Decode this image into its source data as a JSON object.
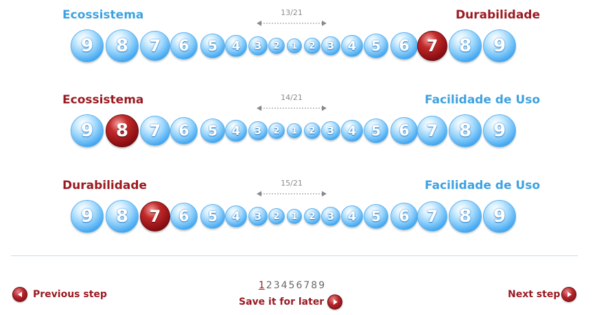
{
  "ball_numbers": [
    "9",
    "8",
    "7",
    "6",
    "5",
    "4",
    "3",
    "2",
    "1",
    "2",
    "3",
    "4",
    "5",
    "6",
    "7",
    "8",
    "9"
  ],
  "colors": {
    "blue_label": "#3ea2e0",
    "red_label": "#9a1b22",
    "selected": "#8c0f14",
    "ball": "#8fd0fb"
  },
  "rows": [
    {
      "counter": "13/21",
      "left_label": "Ecossistema",
      "left_color": "#3ea2e0",
      "right_label": "Durabilidade",
      "right_color": "#9a1b22",
      "selected_index": 14
    },
    {
      "counter": "14/21",
      "left_label": "Ecossistema",
      "left_color": "#9a1b22",
      "right_label": "Facilidade de Uso",
      "right_color": "#3ea2e0",
      "selected_index": 1
    },
    {
      "counter": "15/21",
      "left_label": "Durabilidade",
      "left_color": "#9a1b22",
      "right_label": "Facilidade de Uso",
      "right_color": "#3ea2e0",
      "selected_index": 2
    }
  ],
  "footer": {
    "previous_label": "Previous step",
    "next_label": "Next step",
    "save_label": "Save it for later",
    "pages": [
      "1",
      "2",
      "3",
      "4",
      "5",
      "6",
      "7",
      "8",
      "9"
    ],
    "current_page": "1"
  },
  "icons": {
    "arrow": "double-arrow-icon",
    "prev": "arrow-left-circle-icon",
    "next": "arrow-right-circle-icon"
  }
}
